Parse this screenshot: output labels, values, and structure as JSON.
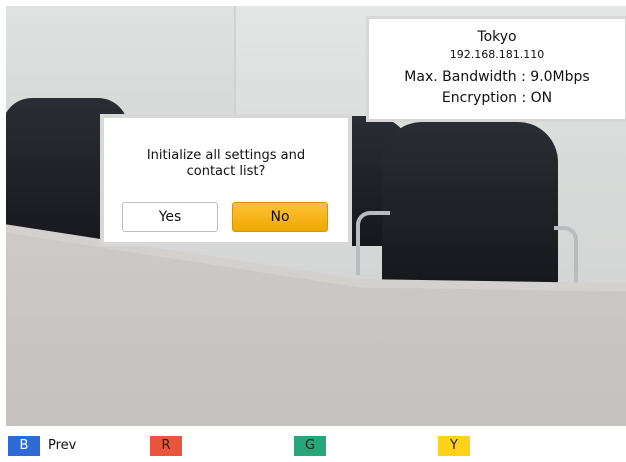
{
  "info_panel": {
    "site_name": "Tokyo",
    "ip_address": "192.168.181.110",
    "max_bandwidth": "Max. Bandwidth : 9.0Mbps",
    "encryption": "Encryption : ON"
  },
  "dialog": {
    "message_line1": "Initialize all settings and",
    "message_line2": "contact list?",
    "yes_label": "Yes",
    "no_label": "No",
    "selected_button": "No"
  },
  "bottom_bar": {
    "keys": [
      {
        "letter": "B",
        "label": "Prev",
        "color": "#2e6bd6"
      },
      {
        "letter": "R",
        "label": "",
        "color": "#e8573d"
      },
      {
        "letter": "G",
        "label": "",
        "color": "#27a679"
      },
      {
        "letter": "Y",
        "label": "",
        "color": "#ffd21a"
      }
    ]
  },
  "colors": {
    "accent": "#f0a800",
    "panel_border": "#d8d8d8"
  }
}
